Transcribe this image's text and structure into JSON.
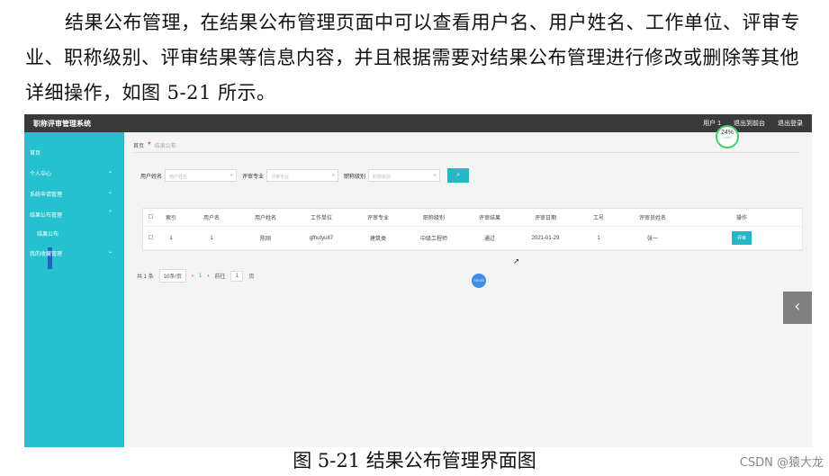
{
  "paragraph": "结果公布管理，在结果公布管理页面中可以查看用户名、用户姓名、工作单位、评审专业、职称级别、评审结果等信息内容，并且根据需要对结果公布管理进行修改或删除等其他详细操作，如图 5-21 所示。",
  "app": {
    "title": "职称评审管理系统",
    "top_menu": [
      "用户 1",
      "退出到前台",
      "退出登录"
    ]
  },
  "sidebar": {
    "items": [
      {
        "label": "首页",
        "expand": false
      },
      {
        "label": "个人中心",
        "expand": true
      },
      {
        "label": "系统申请管理",
        "expand": true
      },
      {
        "label": "结果公布管理",
        "expand": true
      },
      {
        "label": "我的收藏管理",
        "expand": true
      }
    ],
    "sub_item": "结果公布"
  },
  "breadcrumb": {
    "home": "首页",
    "heart": "♥",
    "current": "结果公布"
  },
  "search": {
    "fields": [
      {
        "label": "用户姓名",
        "placeholder": "用户姓名"
      },
      {
        "label": "评审专业",
        "placeholder": "评审专业"
      },
      {
        "label": "职称级别",
        "placeholder": "职称级别"
      }
    ],
    "button": "⌕"
  },
  "table": {
    "headers": [
      "索引",
      "用户名",
      "用户姓名",
      "工作单位",
      "评审专业",
      "职称级别",
      "评审结果",
      "评审日期",
      "工号",
      "评审员姓名",
      "操作"
    ],
    "rows": [
      [
        "1",
        "1",
        "陈刚",
        "gfhutyu87",
        "建筑类",
        "中级工程师",
        "通过",
        "2021-01-29",
        "1",
        "张一"
      ]
    ],
    "op_button": "评审"
  },
  "pager": {
    "total": "共 1 条",
    "page_size": "10条/页",
    "prev": "‹",
    "current": "1",
    "next": "›",
    "goto_prefix": "前往",
    "goto_value": "1",
    "goto_suffix": "页"
  },
  "overlay": {
    "gauge_pct": "24%",
    "gauge_speed": "0.3K/s",
    "blue_badge": "9/0.09",
    "side_arrow": "‹"
  },
  "caption": "图 5-21 结果公布管理界面图",
  "watermark": "CSDN @猿大龙",
  "colors": {
    "sidebar": "#26c1cf",
    "accent": "#26b7c6",
    "topbar": "#3a3a3a"
  }
}
